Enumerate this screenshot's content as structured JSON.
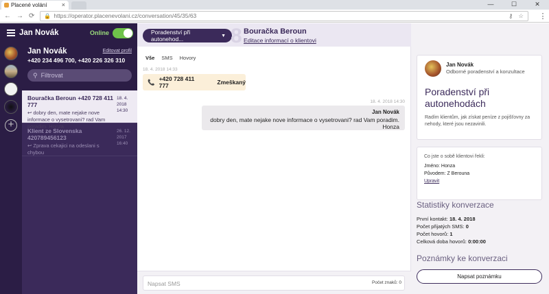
{
  "browser": {
    "tab_title": "Placené volání",
    "url": "https://operator.placenevolani.cz/conversation/45/35/63"
  },
  "sidebar": {
    "operator_name": "Jan Novák",
    "online_label": "Online",
    "profile_name": "Jan Novák",
    "edit_profile": "Editovat profil",
    "phones": "+420 234 496 700, +420 226 326 310",
    "filter_placeholder": "Filtrovat",
    "conversations": [
      {
        "title": "Bouračka Beroun +420 728 411 777",
        "date": "18. 4. 2018 14:30",
        "preview": "↩ dobry den, mate nejake nove informace o vysetrovani? rad Vam poradim. Honza"
      },
      {
        "title": "Klient ze Slovenska 420789456123",
        "date": "26. 12. 2017 16:40",
        "preview": "↩ Zprava cekajici na odeslani s chybou"
      }
    ]
  },
  "header": {
    "service_dropdown": "Poradenství při autonehod...",
    "conversation_title": "Bouračka Beroun",
    "edit_client": "Editace informací o klientovi",
    "bg_number": "8"
  },
  "chat": {
    "tabs": [
      "Vše",
      "SMS",
      "Hovory"
    ],
    "call": {
      "timestamp": "18. 4. 2018 14:33",
      "number": "+420 728 411 777",
      "status": "Zmeškaný"
    },
    "message": {
      "timestamp": "18. 4. 2018 14:30",
      "author": "Jan Novák",
      "text": "dobry den, mate nejake nove informace o vysetrovani? rad Vam poradim. Honza"
    },
    "composer_placeholder": "Napsat SMS",
    "char_count": "Počet znaků: 0"
  },
  "right": {
    "operator_name": "Jan Novák",
    "operator_role": "Odborné poradenství a konzultace",
    "service_title": "Poradenství při autonehodách",
    "service_desc": "Radím klientům, jak získat peníze z pojišťovny za nehody, které jsou nezavinili.",
    "client_heading": "Co jste o sobě klientovi řekli:",
    "client_name": "Jméno: Honza",
    "client_origin": "Původem: Z Berouna",
    "edit": "Upravit",
    "stats_title": "Statistiky konverzace",
    "stats": {
      "first_contact_label": "První kontakt:",
      "first_contact": "18. 4. 2018",
      "sms_label": "Počet přijatých SMS:",
      "sms": "0",
      "calls_label": "Počet hovorů:",
      "calls": "1",
      "duration_label": "Celková doba hovorů:",
      "duration": "0:00:00"
    },
    "notes_title": "Poznámky ke konverzaci",
    "notes_button": "Napsat poznámku"
  }
}
